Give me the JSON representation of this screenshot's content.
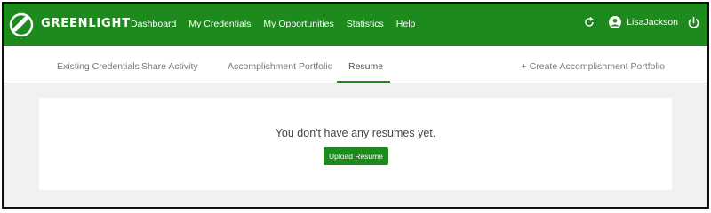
{
  "brand": {
    "name": "GREENLIGHT",
    "icon": "greenlight-logo"
  },
  "nav": {
    "items": [
      {
        "label": "Dashboard"
      },
      {
        "label": "My Credentials"
      },
      {
        "label": "My Opportunities"
      },
      {
        "label": "Statistics"
      },
      {
        "label": "Help"
      }
    ]
  },
  "user": {
    "name": "LisaJackson",
    "refresh_icon": "refresh-icon",
    "user_icon": "user-circle-icon",
    "logout_icon": "power-icon"
  },
  "tabs": [
    {
      "label": "Existing Credentials",
      "active": false
    },
    {
      "label": "Share Activity",
      "active": false
    },
    {
      "label": "Accomplishment Portfolio",
      "active": false
    },
    {
      "label": "Resume",
      "active": true
    }
  ],
  "create_link": {
    "label": "+ Create Accomplishment Portfolio"
  },
  "resume": {
    "empty_message": "You don't have any resumes yet.",
    "upload_label": "Upload Resume"
  },
  "colors": {
    "brand_green": "#1e8a1e",
    "page_bg": "#f1f1f1"
  }
}
